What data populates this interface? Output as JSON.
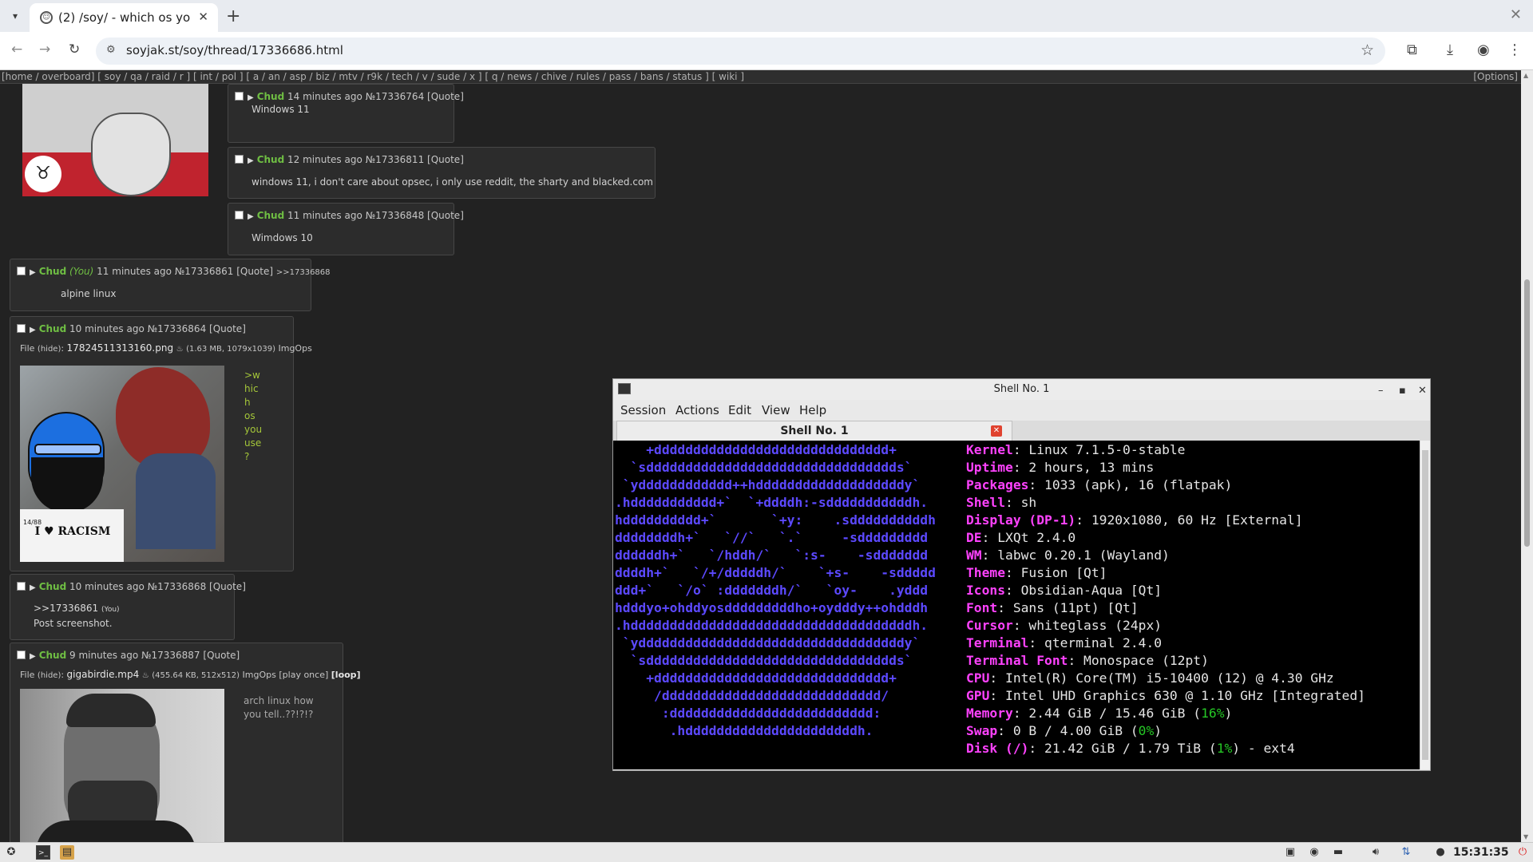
{
  "browser": {
    "tab_title": "(2) /soy/ - which os yo",
    "url": "soyjak.st/soy/thread/17336686.html"
  },
  "board_nav": {
    "links": "[home / overboard] [ soy / qa / raid / r ] [ int / pol ] [ a / an / asp / biz / mtv / r9k / tech / v / sude / x ] [ q / news / chive / rules / pass / bans / status ] [ wiki ]",
    "options": "[Options]"
  },
  "posts": [
    {
      "name": "Chud",
      "time": "14 minutes ago",
      "no": "№17336764",
      "quote": "[Quote]",
      "body": "Windows 11"
    },
    {
      "name": "Chud",
      "time": "12 minutes ago",
      "no": "№17336811",
      "quote": "[Quote]",
      "body": "windows 11, i don't care about opsec, i only use reddit, the sharty and blacked.com"
    },
    {
      "name": "Chud",
      "time": "11 minutes ago",
      "no": "№17336848",
      "quote": "[Quote]",
      "body": "Wimdows 10"
    },
    {
      "name": "Chud",
      "you": "(You)",
      "time": "11 minutes ago",
      "no": "№17336861",
      "quote": "[Quote]",
      "backlink": ">>17336868",
      "body": "alpine linux"
    },
    {
      "name": "Chud",
      "time": "10 minutes ago",
      "no": "№17336864",
      "quote": "[Quote]",
      "file_label": "File",
      "file_hide": "(hide)",
      "file_name": "17824511313160.png",
      "file_meta": "(1.63 MB, 1079x1039)",
      "imgops": "ImgOps",
      "greentext": [
        ">w",
        "hic",
        "h",
        "os",
        "you",
        "use",
        "?"
      ],
      "img_caption": "I ♥ RACISM",
      "img_num": "14/88"
    },
    {
      "name": "Chud",
      "time": "10 minutes ago",
      "no": "№17336868",
      "quote": "[Quote]",
      "quote_link": ">>17336861",
      "quote_you": "(You)",
      "body": "Post screenshot."
    },
    {
      "name": "Chud",
      "time": "9 minutes ago",
      "no": "№17336887",
      "quote": "[Quote]",
      "file_label": "File",
      "file_hide": "(hide)",
      "file_name": "gigabirdie.mp4",
      "file_meta": "(455.64 KB, 512x512)",
      "imgops": "ImgOps",
      "play_once": "[play once]",
      "loop": "[loop]",
      "body_line1": "arch linux how",
      "body_line2": "you tell..??!?!?"
    }
  ],
  "terminal": {
    "window_title": "Shell No. 1",
    "menu": [
      "Session",
      "Actions",
      "Edit",
      "View",
      "Help"
    ],
    "tab_title": "Shell No. 1",
    "ascii_art": "    +dddddddddddddddddddddddddddddd+\n  `sdddddddddddddddddddddddddddddddds`\n `ydddddddddddd++hdddddddddddddddddddy`\n.hddddddddddd+`  `+ddddh:-sdddddddddddh.\nhdddddddddd+`       `+y:    .sddddddddddh\nddddddddh+`   `//`   `.`     -sddddddddd\nddddddh+`   `/hddh/`   `:s-    -sddddddd\nddddh+`   `/+/dddddh/`    `+s-    -sddddd\nddd+`   `/o` :dddddddh/`   `oy-    .yddd\nhdddyo+ohddyosdddddddddho+oydddy++ohdddh\n.hddddddddddddddddddddddddddddddddddddh.\n `yddddddddddddddddddddddddddddddddddy`\n  `sdddddddddddddddddddddddddddddddds`\n    +dddddddddddddddddddddddddddddd+\n     /dddddddddddddddddddddddddddd/\n      :dddddddddddddddddddddddddd:\n       .hddddddddddddddddddddddh.",
    "info": [
      {
        "key": "Kernel",
        "value": ": Linux 7.1.5-0-stable"
      },
      {
        "key": "Uptime",
        "value": ": 2 hours, 13 mins"
      },
      {
        "key": "Packages",
        "value": ": 1033 (apk), 16 (flatpak)"
      },
      {
        "key": "Shell",
        "value": ": sh"
      },
      {
        "key": "Display (DP-1)",
        "value": ": 1920x1080, 60 Hz [External]"
      },
      {
        "key": "DE",
        "value": ": LXQt 2.4.0"
      },
      {
        "key": "WM",
        "value": ": labwc 0.20.1 (Wayland)"
      },
      {
        "key": "Theme",
        "value": ": Fusion [Qt]"
      },
      {
        "key": "Icons",
        "value": ": Obsidian-Aqua [Qt]"
      },
      {
        "key": "Font",
        "value": ": Sans (11pt) [Qt]"
      },
      {
        "key": "Cursor",
        "value": ": whiteglass (24px)"
      },
      {
        "key": "Terminal",
        "value": ": qterminal 2.4.0"
      },
      {
        "key": "Terminal Font",
        "value": ": Monospace (12pt)"
      },
      {
        "key": "CPU",
        "value": ": Intel(R) Core(TM) i5-10400 (12) @ 4.30 GHz"
      },
      {
        "key": "GPU",
        "value": ": Intel UHD Graphics 630 @ 1.10 GHz [Integrated]"
      },
      {
        "key": "Memory",
        "value": ": 2.44 GiB / 15.46 GiB (",
        "pct": "16%",
        "tail": ")"
      },
      {
        "key": "Swap",
        "value": ": 0 B / 4.00 GiB (",
        "pct": "0%",
        "tail": ")"
      },
      {
        "key": "Disk (/)",
        "value": ": 21.42 GiB / 1.79 TiB (",
        "pct": "1%",
        "tail": ") - ext4"
      }
    ]
  },
  "taskbar": {
    "clock": "15:31:35"
  },
  "colors": {
    "name_green": "#6fbe43",
    "greentext": "#a4c639",
    "ascii_blue": "#5c49ff",
    "key_magenta": "#ff42ff"
  }
}
